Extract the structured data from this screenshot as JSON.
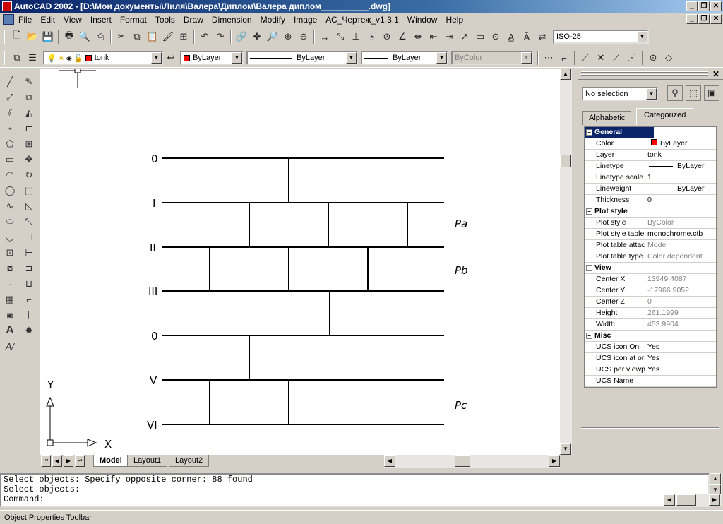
{
  "window": {
    "title": "AutoCAD 2002 - [D:\\Мои документы\\Лиля\\Валера\\Диплом\\Валера диплом__________.dwg]"
  },
  "menu": [
    "File",
    "Edit",
    "View",
    "Insert",
    "Format",
    "Tools",
    "Draw",
    "Dimension",
    "Modify",
    "Image",
    "АС_Чертеж_v1.3.1",
    "Window",
    "Help"
  ],
  "toolbar": {
    "dimstyle": "ISO-25",
    "layer": "tonk",
    "color": "ByLayer",
    "linetype": "ByLayer",
    "lineweight": "ByLayer",
    "plotstyle": "ByColor"
  },
  "drawing": {
    "levels": [
      "0",
      "I",
      "II",
      "III",
      "0",
      "V",
      "VI"
    ],
    "regions": [
      "Pa",
      "Pb",
      "Pc"
    ],
    "ucs": {
      "x": "X",
      "y": "Y"
    }
  },
  "tabs": [
    "Model",
    "Layout1",
    "Layout2"
  ],
  "properties": {
    "selection": "No selection",
    "tabs": [
      "Alphabetic",
      "Categorized"
    ],
    "active_tab": "Categorized",
    "rows": [
      {
        "type": "cat",
        "name": "General"
      },
      {
        "name": "Color",
        "value": "ByLayer",
        "swatch": "#ff0000"
      },
      {
        "name": "Layer",
        "value": "tonk"
      },
      {
        "name": "Linetype",
        "value": "ByLayer",
        "line": true
      },
      {
        "name": "Linetype scale",
        "value": "1"
      },
      {
        "name": "Lineweight",
        "value": "ByLayer",
        "line": true
      },
      {
        "name": "Thickness",
        "value": "0"
      },
      {
        "type": "cat",
        "name": "Plot style"
      },
      {
        "name": "Plot style",
        "value": "ByColor",
        "ro": true
      },
      {
        "name": "Plot style table",
        "value": "monochrome.ctb"
      },
      {
        "name": "Plot table attache",
        "value": "Model",
        "ro": true
      },
      {
        "name": "Plot table type",
        "value": "Color dependent",
        "ro": true
      },
      {
        "type": "cat",
        "name": "View"
      },
      {
        "name": "Center X",
        "value": "13949.4087",
        "ro": true
      },
      {
        "name": "Center Y",
        "value": "-17966.9052",
        "ro": true
      },
      {
        "name": "Center Z",
        "value": "0",
        "ro": true
      },
      {
        "name": "Height",
        "value": "261.1999",
        "ro": true
      },
      {
        "name": "Width",
        "value": "453.9904",
        "ro": true
      },
      {
        "type": "cat",
        "name": "Misc"
      },
      {
        "name": "UCS icon On",
        "value": "Yes"
      },
      {
        "name": "UCS icon at origin",
        "value": "Yes"
      },
      {
        "name": "UCS per viewport",
        "value": "Yes"
      },
      {
        "name": "UCS Name",
        "value": ""
      }
    ]
  },
  "command": {
    "lines": [
      "Select objects: Specify opposite corner: 88 found",
      "Select objects:",
      "Command:"
    ]
  },
  "status": "Object Properties Toolbar",
  "colors": {
    "accent": "#0a246a",
    "bylayer_swatch": "#ff0000"
  }
}
